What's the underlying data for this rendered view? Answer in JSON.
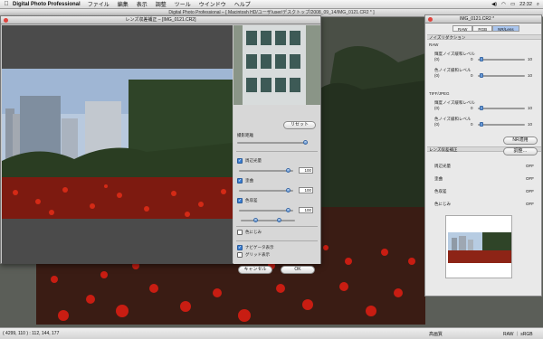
{
  "menubar": {
    "app": "Digital Photo Professional",
    "items": [
      "ファイル",
      "編集",
      "表示",
      "調整",
      "ツール",
      "ウインドウ",
      "ヘルプ"
    ],
    "clock": "22:32"
  },
  "main_title": "Digital Photo Professional – [ Macintosh HD/ユーザ/user/デスクトップ/2008_09_14/IMG_0121.CR2 * ]",
  "lens_window": {
    "title": "レンズ収差補正 – [IMG_0121.CR2]",
    "reset_label": "リセット",
    "shooting_distance_label": "撮影距離",
    "peripheral_label": "周辺光量",
    "peripheral_value": "100",
    "distortion_label": "歪曲",
    "distortion_value": "100",
    "chromatic_label": "色収差",
    "chromatic_value": "100",
    "color_blur_label": "色にじみ",
    "navigator_label": "ナビゲータ表示",
    "grid_label": "グリッド表示",
    "cancel_label": "キャンセル",
    "ok_label": "OK"
  },
  "nr_window": {
    "title": "IMG_0121.CR2 *",
    "tabs": [
      "RAW",
      "RGB",
      "NR/Lens"
    ],
    "noise_section": "ノイズリダクション",
    "raw_label": "RAW",
    "raw_lum_label": "輝度ノイズ緩和レベル",
    "raw_chroma_label": "色ノイズ緩和レベル",
    "tiff_label": "TIFF/JPEG",
    "tiff_lum_label": "輝度ノイズ緩和レベル",
    "tiff_chroma_label": "色ノイズ緩和レベル",
    "scale_min": "0",
    "scale_max": "10",
    "range_hint": "(0)",
    "nr_apply_label": "NR適用",
    "lens_section": "レンズ収差補正",
    "adjust_label": "調整…",
    "rows": [
      {
        "label": "周辺光量",
        "value": "OFF"
      },
      {
        "label": "歪曲",
        "value": "OFF"
      },
      {
        "label": "色収差",
        "value": "OFF"
      },
      {
        "label": "色にじみ",
        "value": "OFF"
      }
    ]
  },
  "status": {
    "coords": "( 4299, 110 ) : 112, 144, 177",
    "zoom": "高画質",
    "format": "RAW  ｜ sRGB"
  }
}
